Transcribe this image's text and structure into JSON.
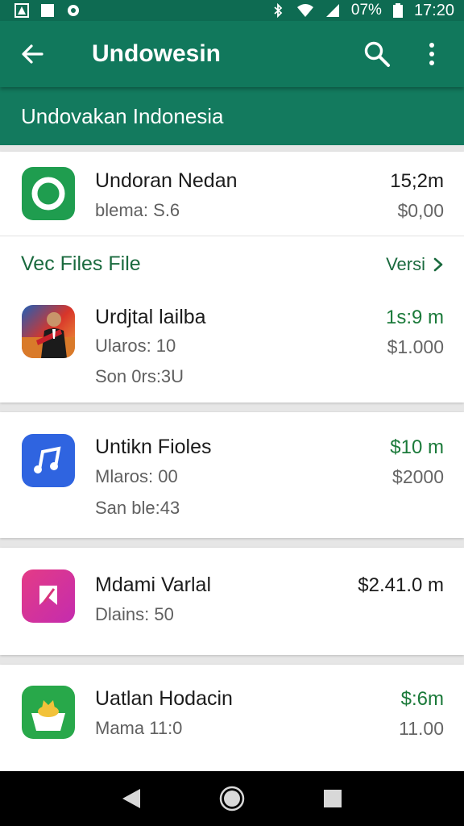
{
  "status": {
    "battery_text": "07%",
    "time": "17:20"
  },
  "app_bar": {
    "title": "Undowesin",
    "back_icon": "arrow-left-icon",
    "search_icon": "search-icon",
    "menu_icon": "more-vert-icon"
  },
  "sub_header": {
    "title": "Undovakan Indonesia"
  },
  "items": [
    {
      "title": "Undoran Nedan",
      "line1": "blema: S.6",
      "line2": "",
      "price": "15;2m",
      "price_color": "#1c1c1c",
      "price2": "$0,00",
      "icon": "circle-ring-icon"
    },
    {
      "title": "Urdjtal lailba",
      "line1": "Ularos: 10",
      "line2": "Son 0rs:3U",
      "price": "1s:9 m",
      "price_color": "#1b7a3a",
      "price2": "$1.000",
      "icon": "person-photo-icon"
    },
    {
      "title": "Untikn Fioles",
      "line1": "Mlaros: 00",
      "line2": "San ble:43",
      "price": "$10 m",
      "price_color": "#1b7a3a",
      "price2": "$2000",
      "icon": "music-note-icon"
    },
    {
      "title": "Mdami Varlal",
      "line1": "Dlains: 50",
      "line2": "",
      "price": "$2.41.0 m",
      "price_color": "#1c1c1c",
      "price2": "",
      "icon": "pink-app-icon"
    },
    {
      "title": "Uatlan Hodacin",
      "line1": "Mama 11:0",
      "line2": "",
      "price": "$:6m",
      "price_color": "#1b7a3a",
      "price2": "11.00",
      "icon": "crown-box-icon"
    }
  ],
  "section": {
    "title": "Vec Files File",
    "link": "Versi",
    "link_icon": "chevron-right-icon"
  },
  "nav": {
    "back_icon": "nav-back-icon",
    "home_icon": "nav-home-icon",
    "recents_icon": "nav-recents-icon"
  },
  "colors": {
    "primary": "#11785c",
    "primary_dark": "#0e6b52",
    "accent_green": "#1b7a3a"
  }
}
